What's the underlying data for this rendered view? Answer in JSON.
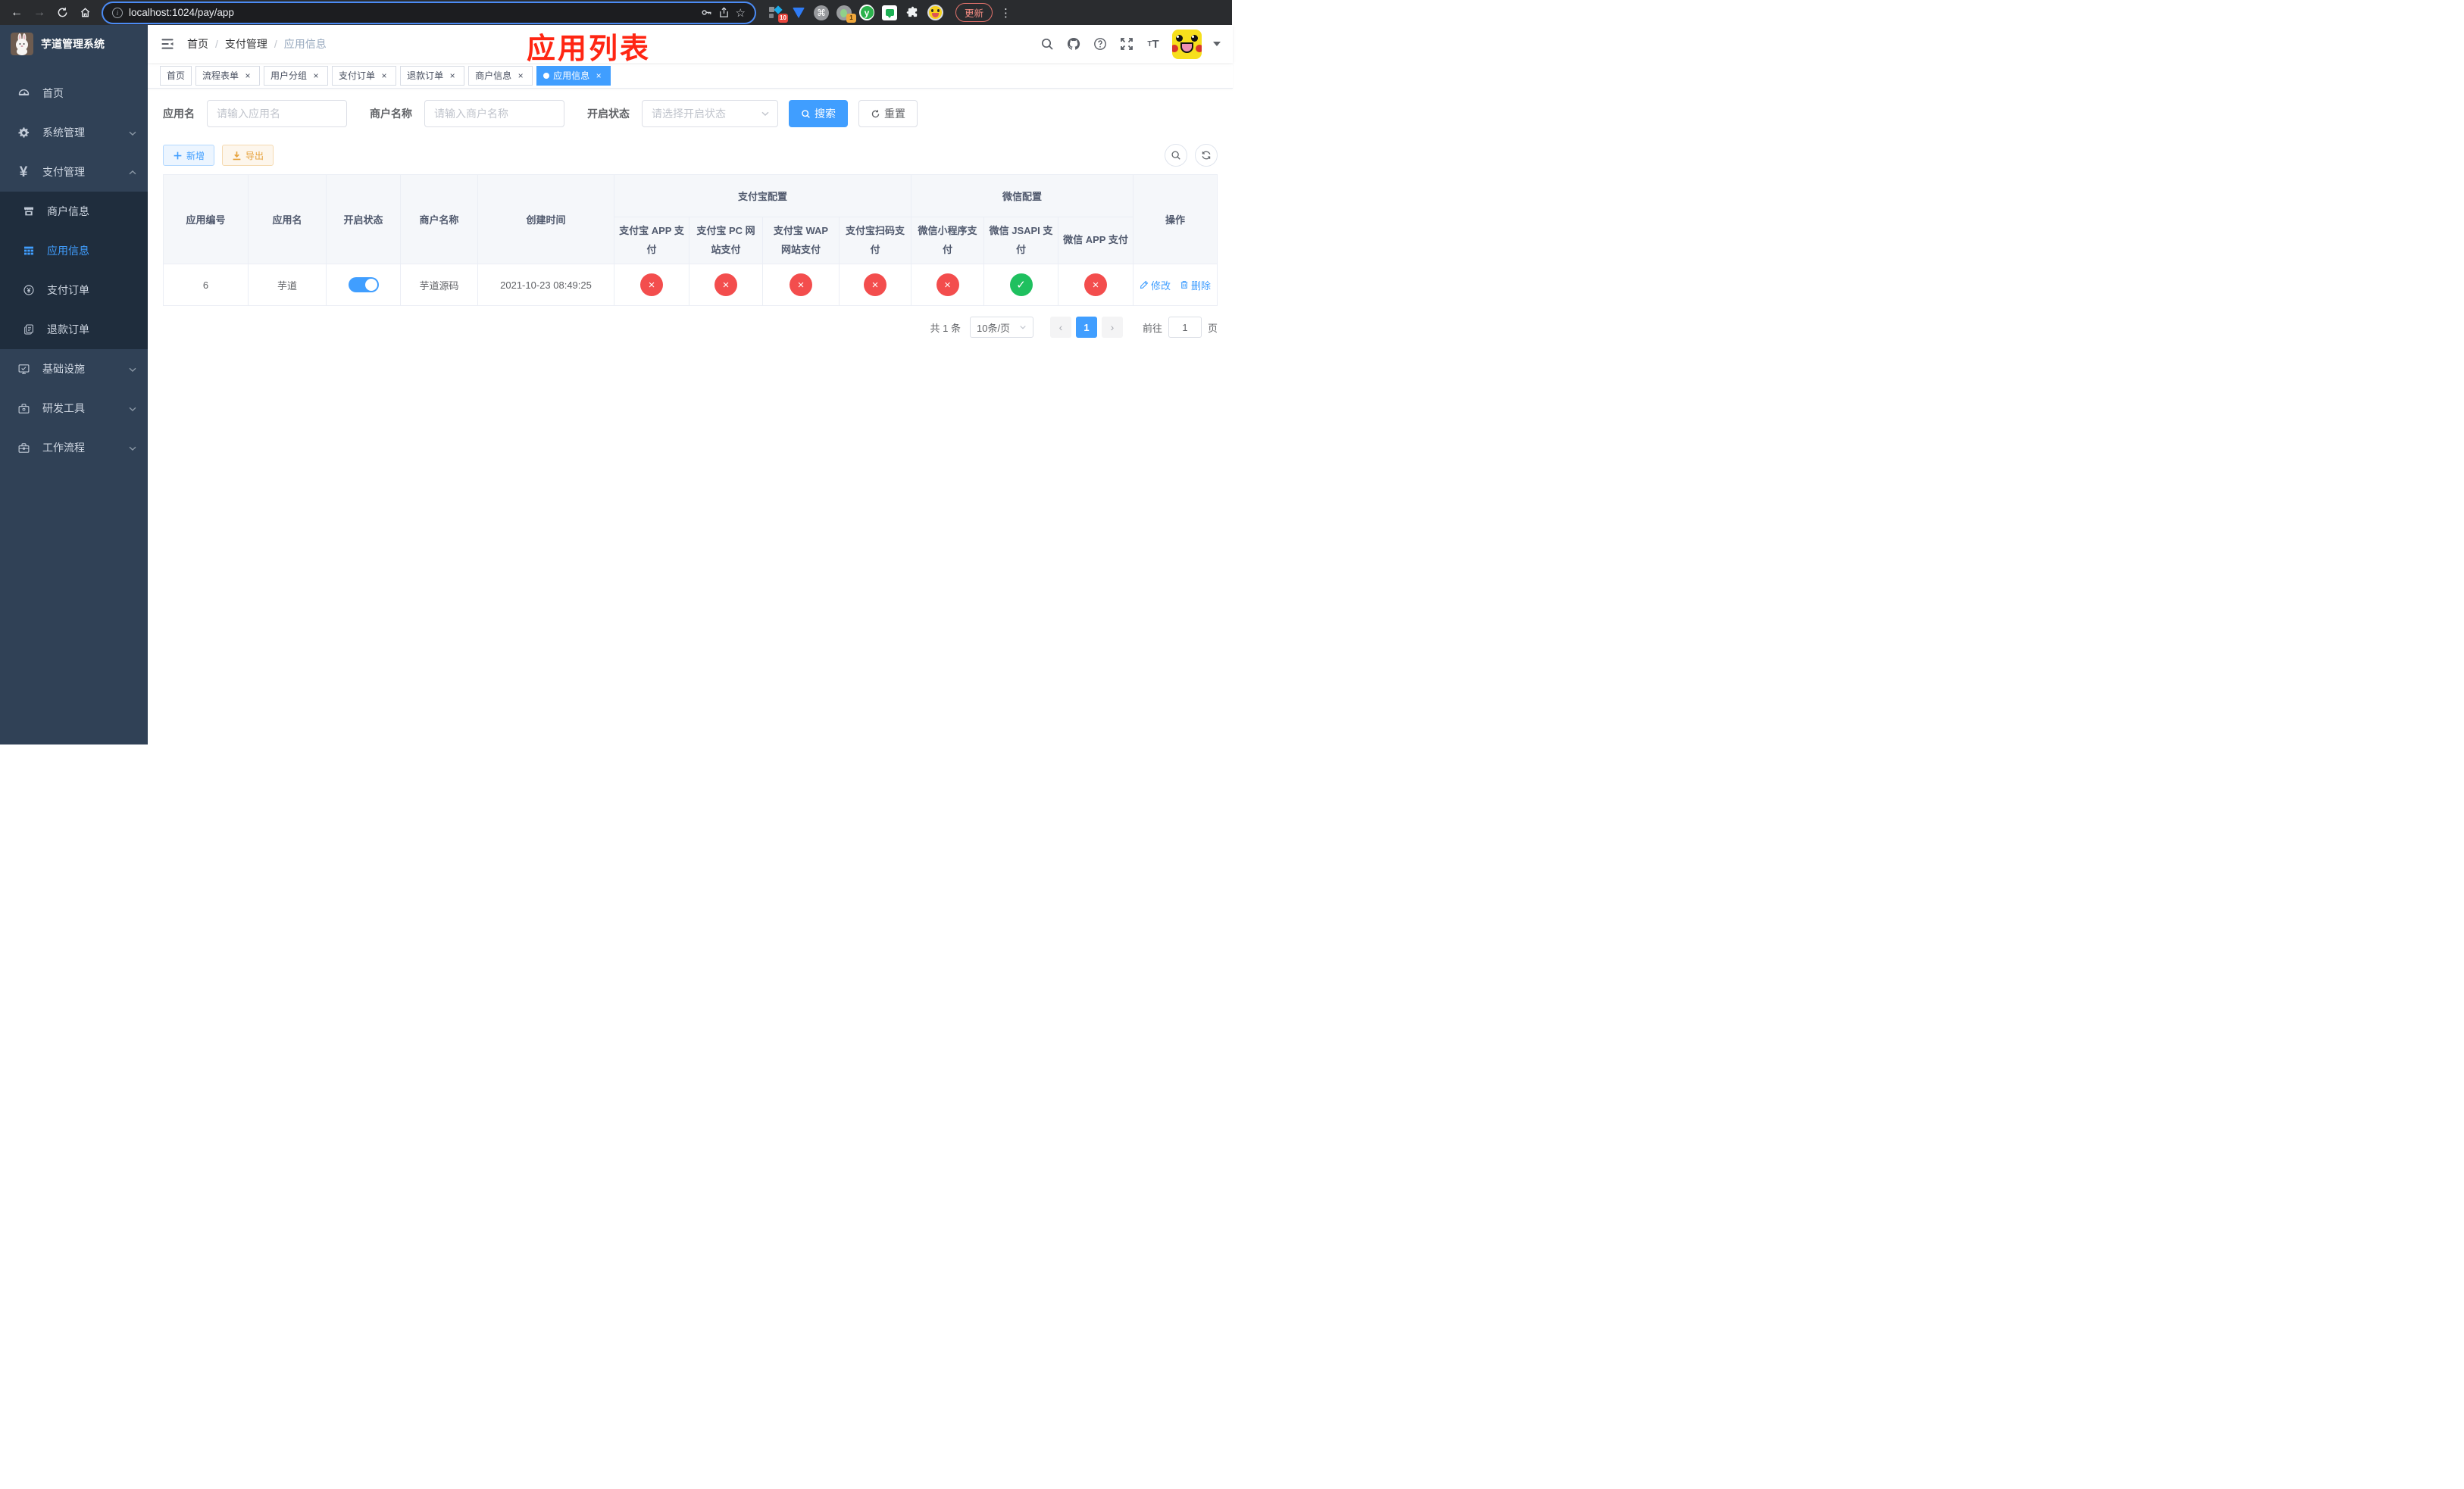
{
  "colors": {
    "accent": "#409eff",
    "danger": "#f34d4d",
    "success": "#1fc05f",
    "warning": "#e6a23c",
    "annotation_red": "#ff2613",
    "sidebar_bg": "#304156",
    "submenu_bg": "#1f2d3d"
  },
  "browser": {
    "url": "localhost:1024/pay/app",
    "update_label": "更新",
    "ext_badge_grid": "10",
    "ext_badge_camera": "1",
    "icons": [
      "back-icon",
      "forward-icon",
      "reload-icon",
      "home-icon",
      "info-icon",
      "key-icon",
      "share-icon",
      "bookmark-star-icon",
      "extensions-puzzle-icon",
      "profile-avatar",
      "more-menu-icon"
    ]
  },
  "sidebar": {
    "title": "芋道管理系统",
    "items": [
      {
        "label": "首页",
        "icon": "dashboard-icon"
      },
      {
        "label": "系统管理",
        "icon": "gear-icon",
        "chevron": "down"
      },
      {
        "label": "支付管理",
        "icon": "yen-icon",
        "chevron": "up",
        "expanded": true
      },
      {
        "label": "基础设施",
        "icon": "monitor-icon",
        "chevron": "down"
      },
      {
        "label": "研发工具",
        "icon": "toolbox-icon",
        "chevron": "down"
      },
      {
        "label": "工作流程",
        "icon": "briefcase-icon",
        "chevron": "down"
      }
    ],
    "submenu": [
      {
        "label": "商户信息",
        "icon": "shop-icon",
        "active": false
      },
      {
        "label": "应用信息",
        "icon": "grid-icon",
        "active": true
      },
      {
        "label": "支付订单",
        "icon": "yen-circle-icon",
        "active": false
      },
      {
        "label": "退款订单",
        "icon": "document-icon",
        "active": false
      }
    ]
  },
  "header": {
    "breadcrumb": [
      "首页",
      "支付管理",
      "应用信息"
    ],
    "annotation": "应用列表",
    "right_icons": [
      "search-icon",
      "github-icon",
      "help-icon",
      "fullscreen-icon",
      "font-size-icon",
      "avatar",
      "caret-down-icon"
    ]
  },
  "tabs": [
    {
      "label": "首页",
      "closable": false,
      "active": false
    },
    {
      "label": "流程表单",
      "closable": true,
      "active": false
    },
    {
      "label": "用户分组",
      "closable": true,
      "active": false
    },
    {
      "label": "支付订单",
      "closable": true,
      "active": false
    },
    {
      "label": "退款订单",
      "closable": true,
      "active": false
    },
    {
      "label": "商户信息",
      "closable": true,
      "active": false
    },
    {
      "label": "应用信息",
      "closable": true,
      "active": true
    }
  ],
  "filter": {
    "app_name_label": "应用名",
    "app_name_placeholder": "请输入应用名",
    "merchant_label": "商户名称",
    "merchant_placeholder": "请输入商户名称",
    "status_label": "开启状态",
    "status_placeholder": "请选择开启状态",
    "search_label": "搜索",
    "reset_label": "重置"
  },
  "toolbar": {
    "add_label": "新增",
    "export_label": "导出"
  },
  "table": {
    "columns": [
      "应用编号",
      "应用名",
      "开启状态",
      "商户名称",
      "创建时间"
    ],
    "groups": [
      "支付宝配置",
      "微信配置"
    ],
    "subcolumns": [
      "支付宝 APP 支付",
      "支付宝 PC 网站支付",
      "支付宝 WAP 网站支付",
      "支付宝扫码支付",
      "微信小程序支付",
      "微信 JSAPI 支付",
      "微信 APP 支付"
    ],
    "actions_header": "操作",
    "icons": {
      "fail": "×",
      "success": "✓"
    },
    "row": {
      "id": "6",
      "name": "芋道",
      "status": "on",
      "merchant": "芋道源码",
      "created_at": "2021-10-23 08:49:25",
      "channel_states": [
        "fail",
        "fail",
        "fail",
        "fail",
        "fail",
        "success",
        "fail"
      ],
      "edit_label": "修改",
      "delete_label": "删除"
    }
  },
  "pagination": {
    "total": "共 1 条",
    "page_size": "10条/页",
    "current_page": "1",
    "goto_label": "前往",
    "goto_value": "1",
    "page_suffix": "页"
  }
}
